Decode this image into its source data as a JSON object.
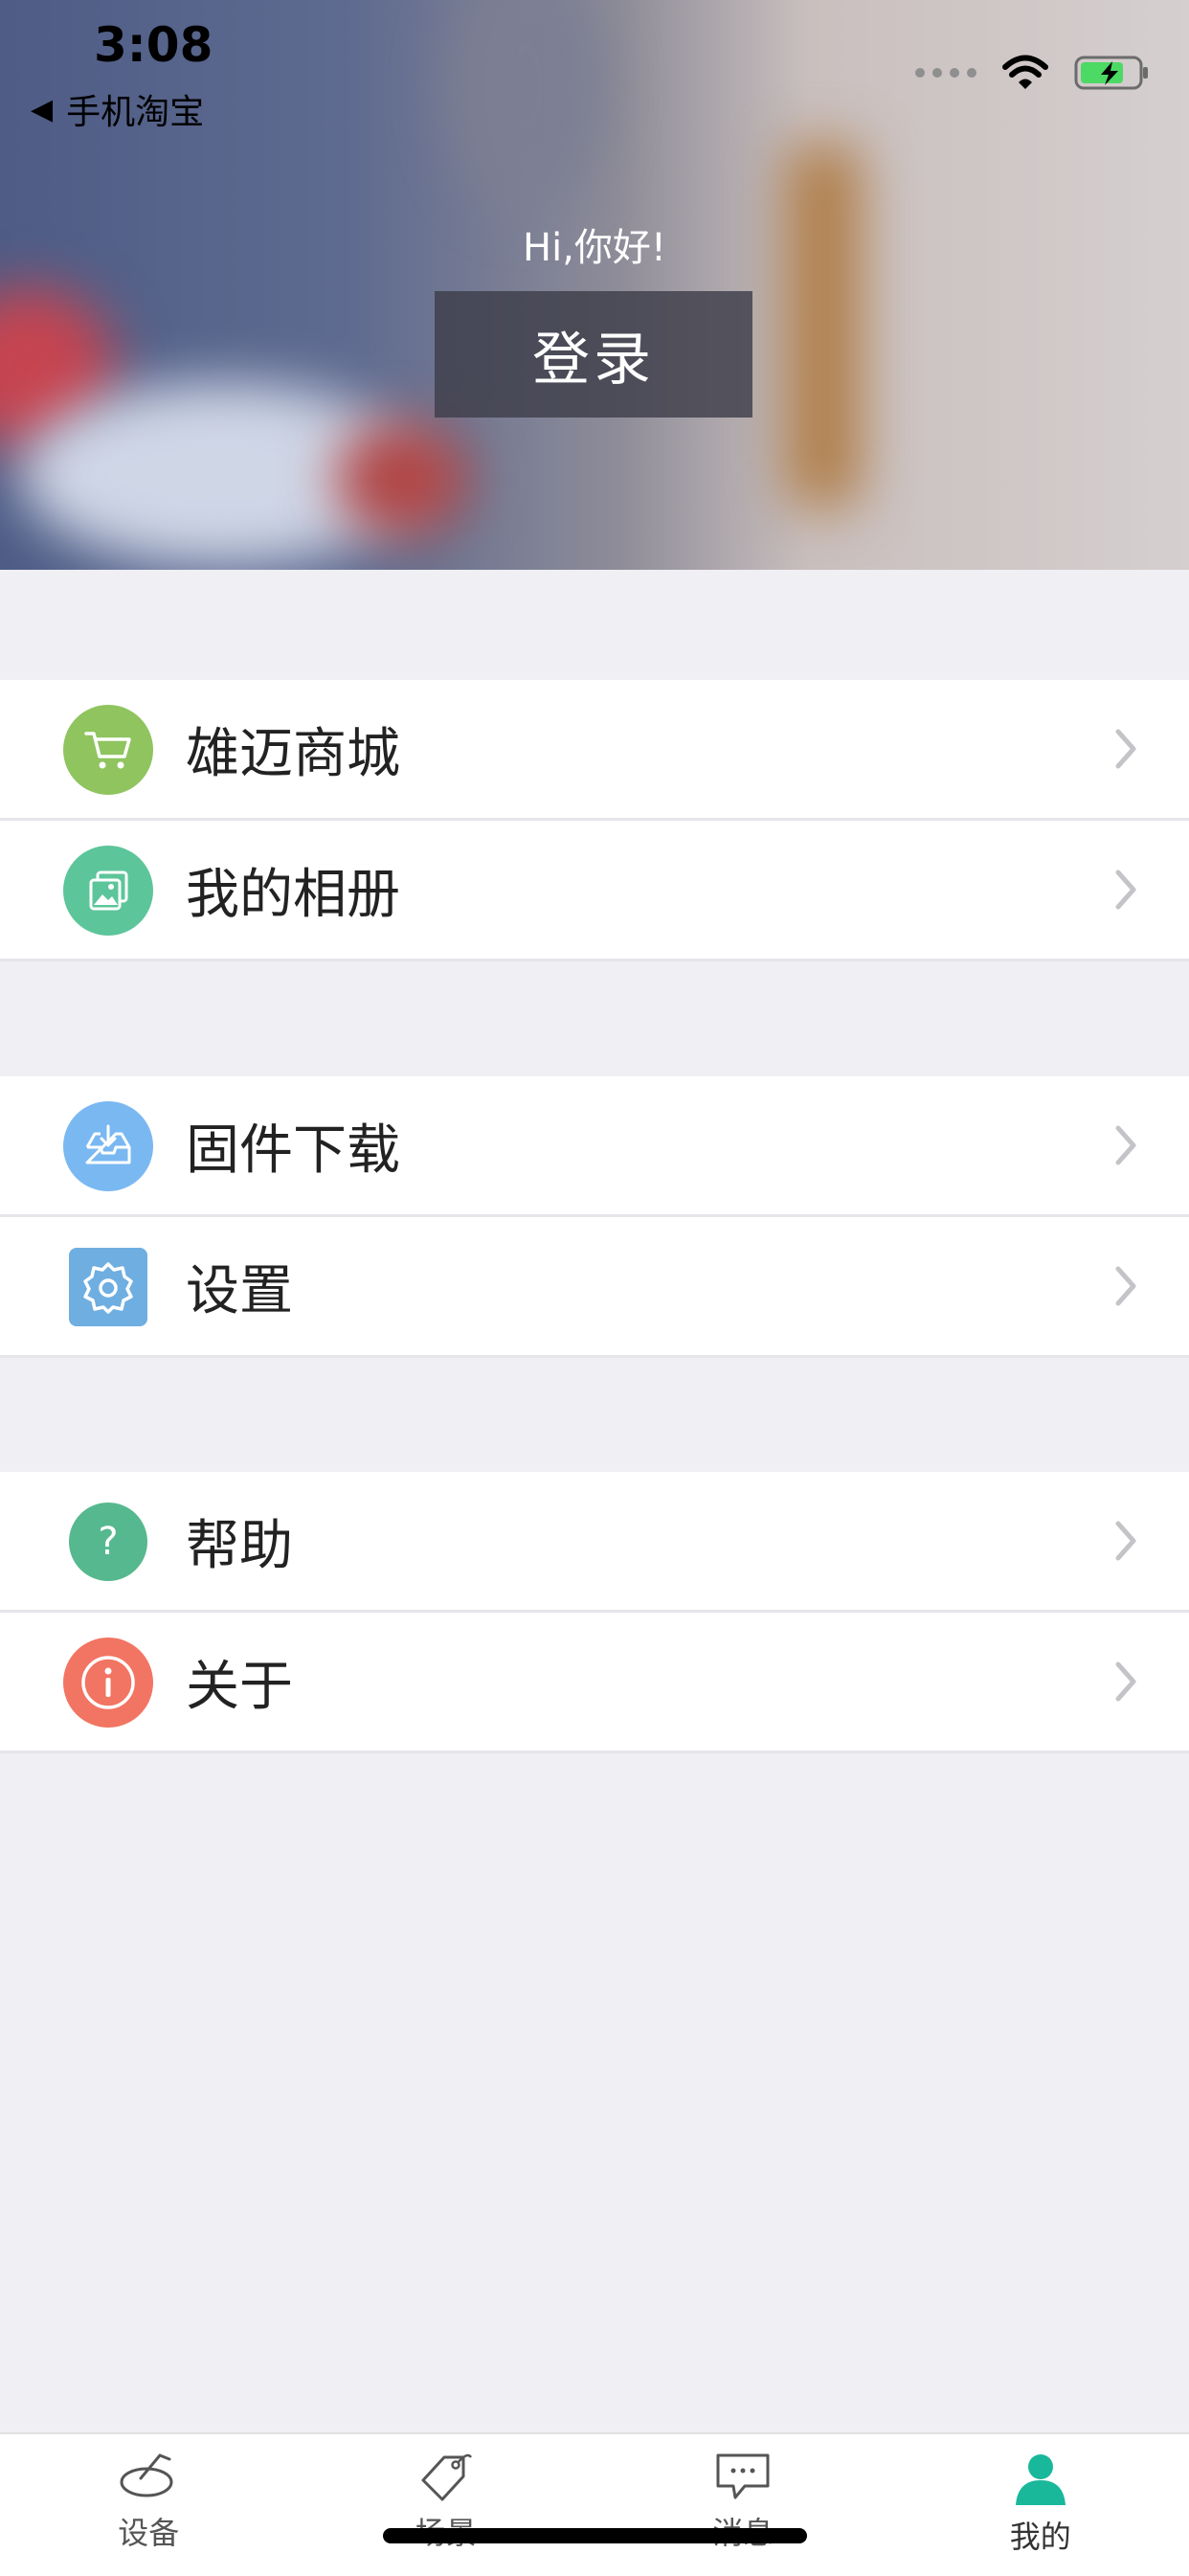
{
  "status_bar": {
    "time": "3:08",
    "back_app": "手机淘宝"
  },
  "header": {
    "greeting": "Hi,你好!",
    "login_label": "登录"
  },
  "menu_groups": [
    {
      "items": [
        {
          "label": "雄迈商城",
          "icon": "cart-icon",
          "color": "#8fc45f"
        },
        {
          "label": "我的相册",
          "icon": "album-icon",
          "color": "#5cc59a"
        }
      ]
    },
    {
      "items": [
        {
          "label": "固件下载",
          "icon": "download-tray-icon",
          "color": "#7ab8f2"
        },
        {
          "label": "设置",
          "icon": "gear-icon",
          "color": "#6faee0"
        }
      ]
    },
    {
      "items": [
        {
          "label": "帮助",
          "icon": "help-icon",
          "color": "#56b88e"
        },
        {
          "label": "关于",
          "icon": "info-icon",
          "color": "#f27462"
        }
      ]
    }
  ],
  "tabbar": {
    "items": [
      {
        "label": "设备",
        "icon": "device-icon"
      },
      {
        "label": "场景",
        "icon": "tag-icon"
      },
      {
        "label": "消息",
        "icon": "message-icon"
      },
      {
        "label": "我的",
        "icon": "person-icon",
        "active": true
      }
    ],
    "active_color": "#19b89a"
  }
}
